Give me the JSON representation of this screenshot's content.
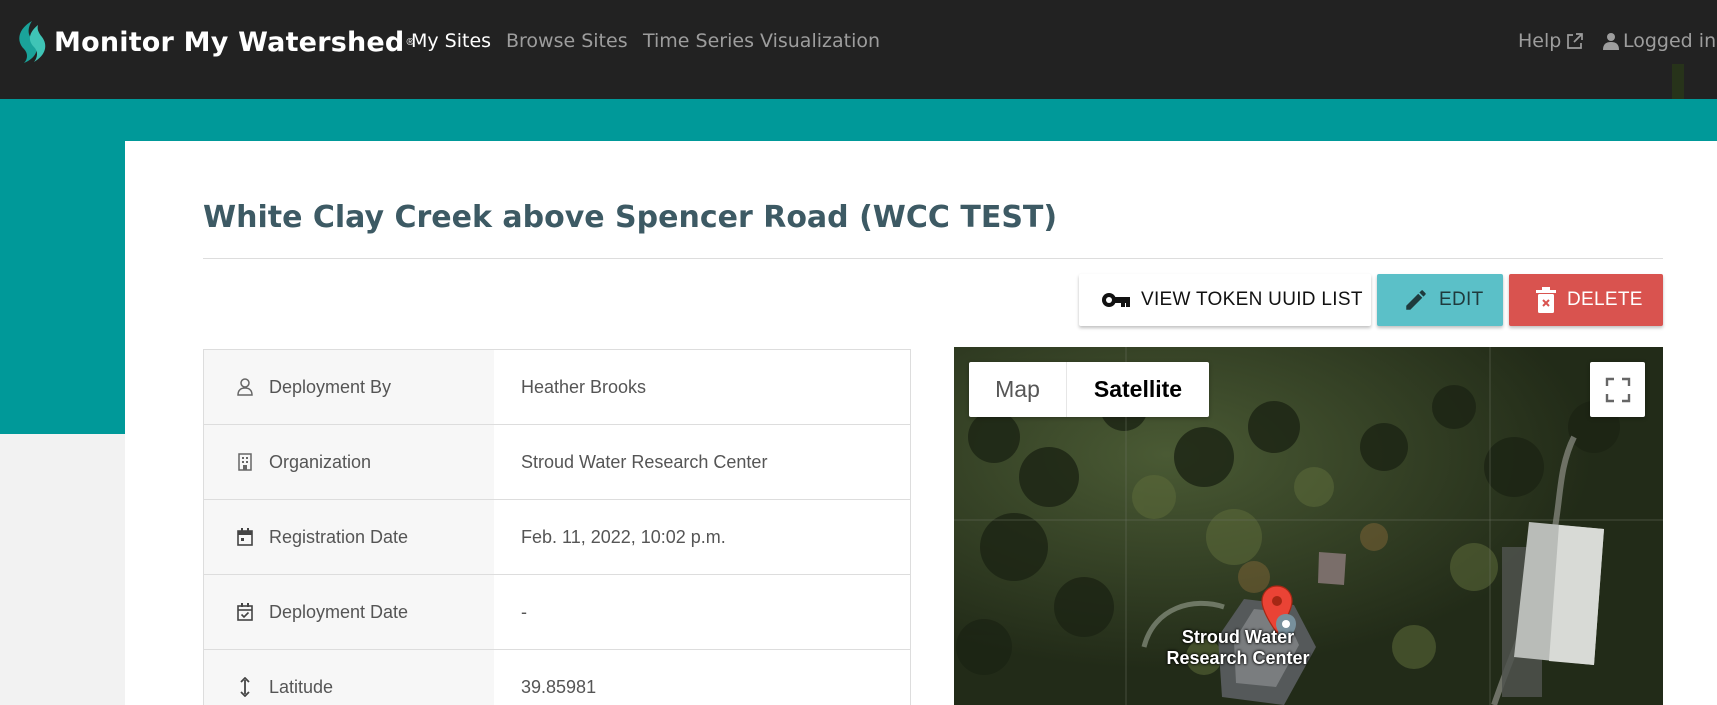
{
  "navbar": {
    "brand": "Monitor My Watershed",
    "brand_mark": "®",
    "links": [
      "My Sites",
      "Browse Sites",
      "Time Series Visualization"
    ],
    "help": "Help",
    "user": "Logged in"
  },
  "site": {
    "title": "White Clay Creek above Spencer Road (WCC TEST)"
  },
  "actions": {
    "token": "VIEW TOKEN UUID LIST",
    "edit": "EDIT",
    "delete": "DELETE"
  },
  "details": [
    {
      "label": "Deployment By",
      "value": "Heather Brooks",
      "icon": "user-icon"
    },
    {
      "label": "Organization",
      "value": "Stroud Water Research Center",
      "icon": "building-icon"
    },
    {
      "label": "Registration Date",
      "value": "Feb. 11, 2022, 10:02 p.m.",
      "icon": "calendar-icon"
    },
    {
      "label": "Deployment Date",
      "value": "-",
      "icon": "calendar-check-icon"
    },
    {
      "label": "Latitude",
      "value": "39.85981",
      "icon": "vertical-arrows-icon"
    }
  ],
  "map": {
    "type_map": "Map",
    "type_satellite": "Satellite",
    "marker_label_line1": "Stroud Water",
    "marker_label_line2": "Research Center"
  },
  "colors": {
    "navbar": "#222222",
    "accent": "#009999",
    "edit": "#5bc0c8",
    "delete": "#d9534f",
    "marker": "#ea4335"
  }
}
